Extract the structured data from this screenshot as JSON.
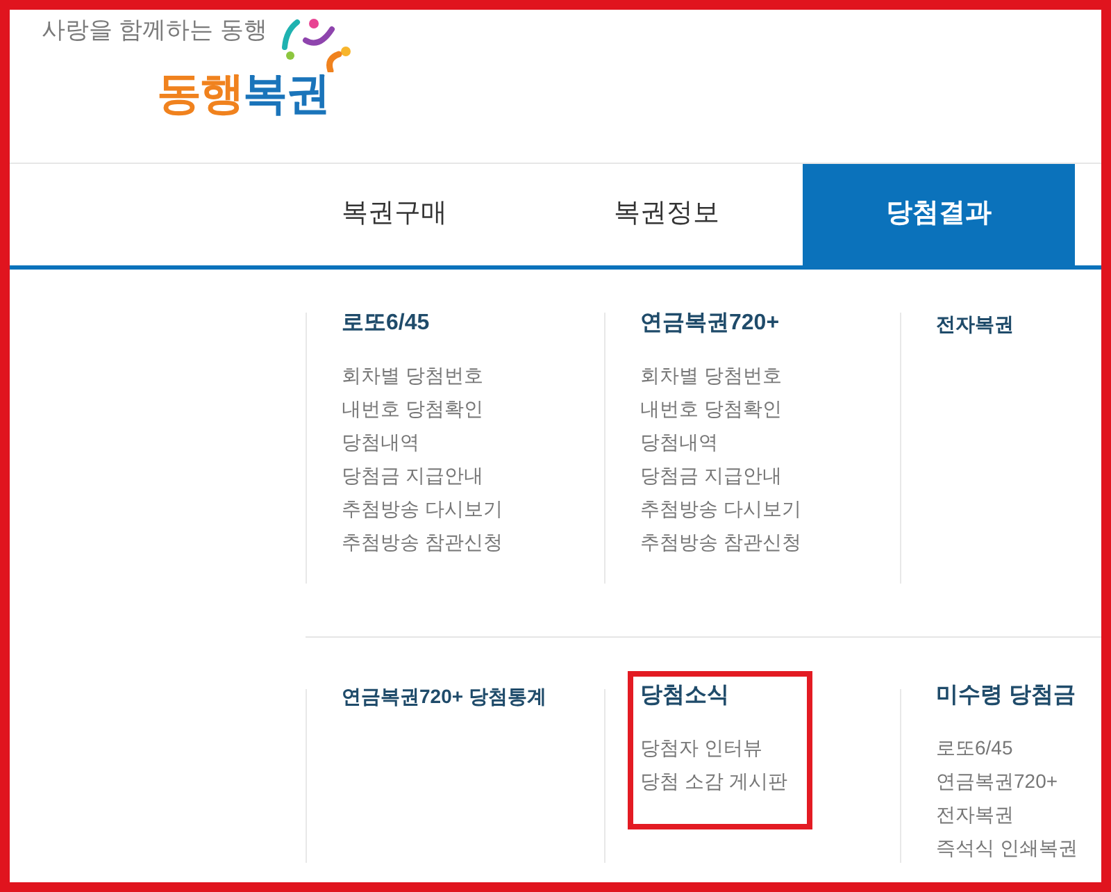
{
  "logo": {
    "tagline": "사랑을 함께하는 동행",
    "wordmark": [
      {
        "text": "동행",
        "color": "#f0821e"
      },
      {
        "text": "복권",
        "color": "#1a74ba"
      }
    ]
  },
  "nav": {
    "tabs": [
      {
        "label": "복권구매",
        "selected": false
      },
      {
        "label": "복권정보",
        "selected": false
      },
      {
        "label": "당첨결과",
        "selected": true
      }
    ]
  },
  "menu": {
    "rows": [
      {
        "sections": [
          {
            "title": "로또6/45",
            "highlighted": false,
            "items": [
              "회차별 당첨번호",
              "내번호 당첨확인",
              "당첨내역",
              "당첨금 지급안내",
              "추첨방송 다시보기",
              "추첨방송 참관신청"
            ]
          },
          {
            "title": "연금복권720+",
            "highlighted": false,
            "items": [
              "회차별 당첨번호",
              "내번호 당첨확인",
              "당첨내역",
              "당첨금 지급안내",
              "추첨방송 다시보기",
              "추첨방송 참관신청"
            ]
          },
          {
            "title": "전자복권",
            "highlighted": false
          }
        ]
      },
      {
        "sections": [
          {
            "title": "연금복권720+ 당첨통계",
            "highlighted": false
          },
          {
            "title": "당첨소식",
            "highlighted": true,
            "items": [
              "당첨자 인터뷰",
              "당첨 소감 게시판"
            ]
          },
          {
            "title": "미수령 당첨금",
            "highlighted": false,
            "items": [
              "로또6/45",
              "연금복권720+",
              "전자복권",
              "즉석식 인쇄복권"
            ]
          }
        ]
      }
    ]
  }
}
